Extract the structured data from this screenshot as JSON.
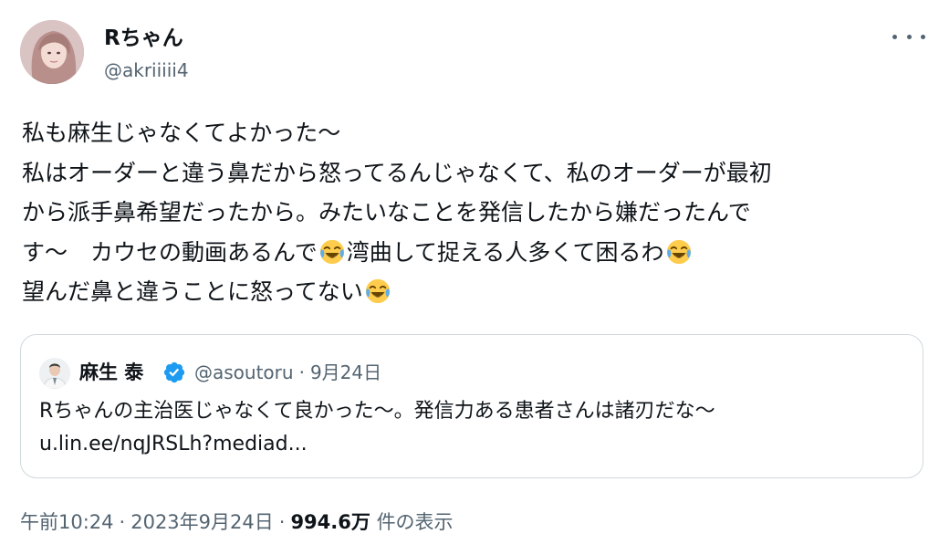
{
  "author": {
    "display_name": "Rちゃん",
    "handle": "@akriiiii4"
  },
  "more_icon": "more-horizontal-icon",
  "tweet": {
    "lines": [
      "私も麻生じゃなくてよかった〜",
      "私はオーダーと違う鼻だから怒ってるんじゃなくて、私のオーダーが最初",
      "から派手鼻希望だったから。みたいなことを発信したから嫌だったんで",
      "す〜　カウセの動画あるんで",
      "湾曲して捉える人多くて困るわ",
      "望んだ鼻と違うことに怒ってない"
    ],
    "emoji": "face-with-tears-of-joy-icon"
  },
  "quote": {
    "display_name": "麻生 泰",
    "verified_icon": "verified-badge-icon",
    "handle": "@asoutoru",
    "separator": "·",
    "date": "9月24日",
    "lines": [
      "Rちゃんの主治医じゃなくて良かった〜。発信力ある患者さんは諸刃だな〜",
      "u.lin.ee/nqJRSLh?mediad..."
    ]
  },
  "meta": {
    "time": "午前10:24",
    "separator": "·",
    "date": "2023年9月24日",
    "views": "994.6万",
    "views_label": "件の表示"
  },
  "colors": {
    "text": "#0f1419",
    "secondary": "#536471",
    "border": "#cfd9de",
    "verified": "#1d9bf0"
  }
}
